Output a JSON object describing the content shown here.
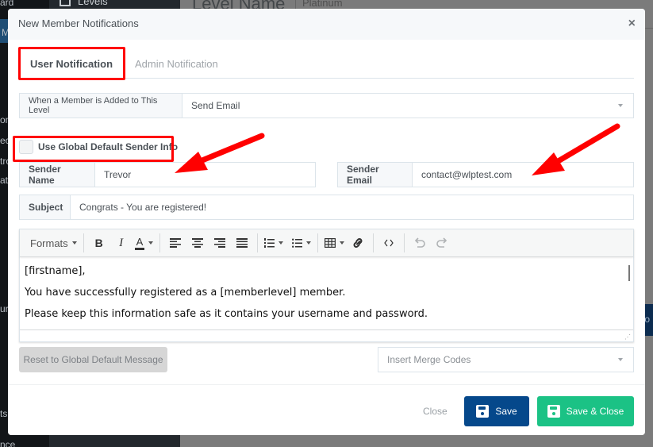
{
  "background": {
    "sidebar_items": [
      "ard",
      "M",
      "on",
      "ec",
      "tro",
      "ati",
      "ur",
      "ts",
      "nce"
    ],
    "levels_label": "Levels",
    "page_heading": "Level Name",
    "level_value": "Platinum",
    "navy_text": "to"
  },
  "modal": {
    "title": "New Member Notifications",
    "close_icon": "×",
    "tabs": [
      {
        "label": "User Notification",
        "active": true
      },
      {
        "label": "Admin Notification",
        "active": false
      }
    ],
    "trigger": {
      "label": "When a Member is Added to This Level",
      "value": "Send Email"
    },
    "use_global_sender": {
      "label": "Use Global Default Sender Info",
      "checked": false
    },
    "sender_name": {
      "label": "Sender Name",
      "value": "Trevor"
    },
    "sender_email": {
      "label": "Sender Email",
      "value": "contact@wlptest.com"
    },
    "subject": {
      "label": "Subject",
      "value": "Congrats - You are registered!"
    },
    "editor": {
      "toolbar": {
        "formats_label": "Formats",
        "bold": "B",
        "italic": "I",
        "text_color": "A"
      },
      "body": [
        "[firstname],",
        "You have successfully registered as a [memberlevel] member.",
        "Please keep this information safe as it contains your username and password."
      ]
    },
    "reset_button": "Reset to Global Default Message",
    "merge_codes_placeholder": "Insert Merge Codes",
    "footer": {
      "close_label": "Close",
      "save_label": "Save",
      "save_close_label": "Save & Close"
    }
  },
  "colors": {
    "save": "#05488b",
    "save_close": "#1bc285",
    "annotation": "#ff0000"
  }
}
